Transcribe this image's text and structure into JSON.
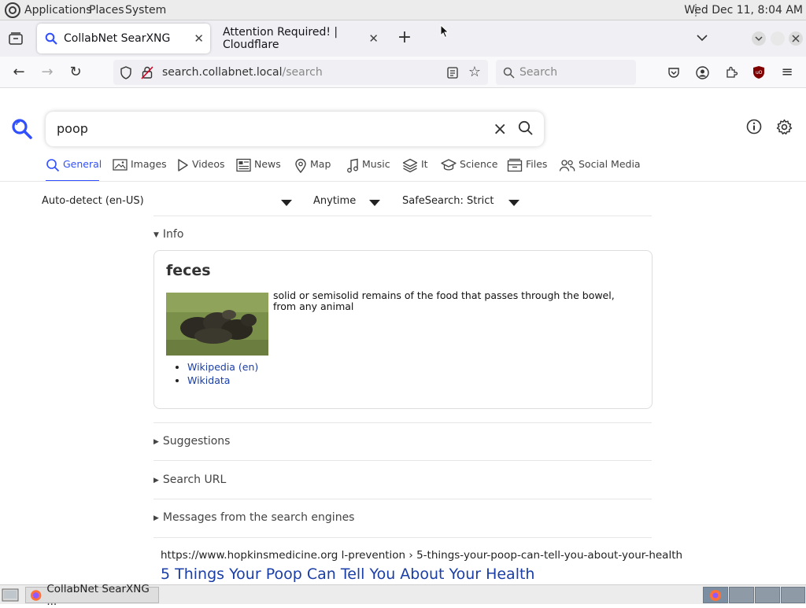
{
  "top_panel": {
    "menus": [
      "Applications",
      "Places",
      "System"
    ],
    "clock": "Wed Dec 11,  8:04 AM"
  },
  "browser": {
    "tabs": [
      {
        "label": "CollabNet SearXNG",
        "active": true
      },
      {
        "label": "Attention Required! | Cloudflare",
        "active": false
      }
    ],
    "url_host": "search.collabnet.local",
    "url_path": "/search",
    "search_placeholder": "Search"
  },
  "searx": {
    "query": "poop",
    "categories": [
      "General",
      "Images",
      "Videos",
      "News",
      "Map",
      "Music",
      "It",
      "Science",
      "Files",
      "Social Media"
    ],
    "active_category": "General",
    "filters": {
      "language": "Auto-detect (en-US)",
      "time": "Anytime",
      "safesearch": "SafeSearch: Strict"
    },
    "info_label": "Info",
    "infobox": {
      "title": "feces",
      "description": "solid or semisolid remains of the food that passes through the bowel, from any animal",
      "links": [
        "Wikipedia (en)",
        "Wikidata"
      ]
    },
    "sections": [
      "Suggestions",
      "Search URL",
      "Messages from the search engines"
    ],
    "result": {
      "url": "https://www.hopkinsmedicine.org  l-prevention › 5-things-your-poop-can-tell-you-about-your-health",
      "title": "5 Things Your Poop Can Tell You About Your Health"
    }
  },
  "taskbar": {
    "task_label": "CollabNet SearXNG ..."
  }
}
